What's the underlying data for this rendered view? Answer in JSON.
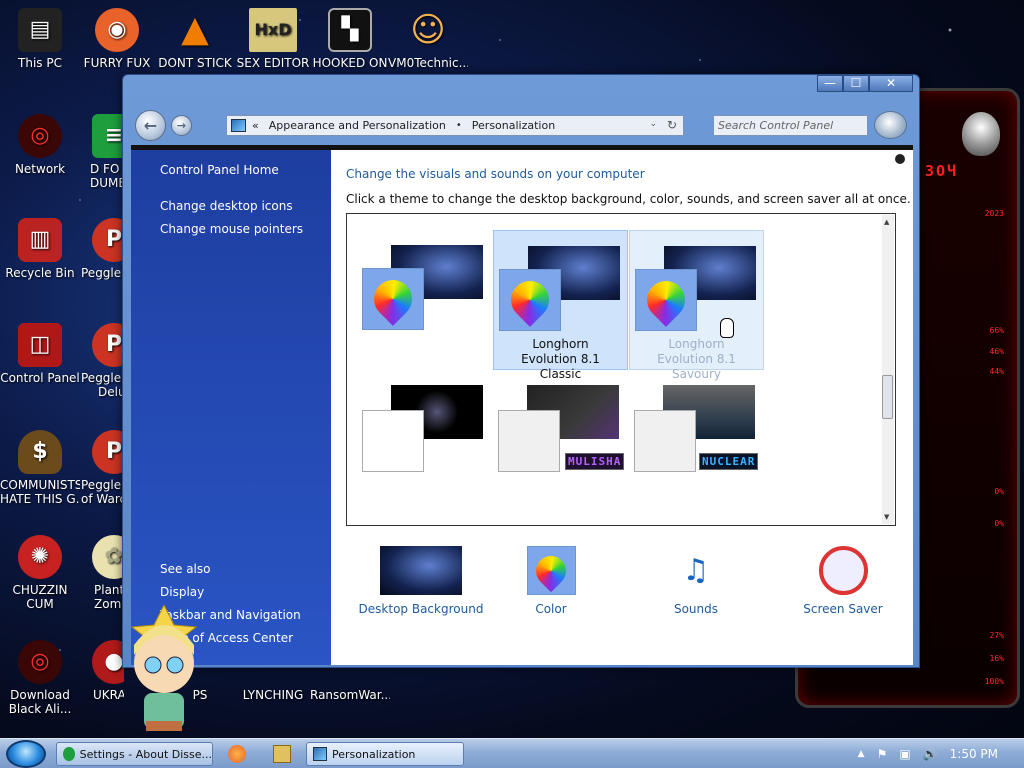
{
  "desktop": {
    "icons": [
      {
        "label": "This PC",
        "color": "#222222",
        "glyph": "▤"
      },
      {
        "label": "FURRY FUX",
        "color": "#e8622a",
        "glyph": "◉"
      },
      {
        "label": "DONT STICK",
        "color": "#f07c00",
        "glyph": "▲"
      },
      {
        "label": "SEX EDITOR",
        "color": "#d6c77d",
        "glyph": "HxD"
      },
      {
        "label": "HOOKED ON",
        "color": "#111111",
        "glyph": "▚"
      },
      {
        "label": "VM0Technic...",
        "color": "#f2b24d",
        "glyph": "☺"
      },
      {
        "label": "Network",
        "color": "#c21f1f",
        "glyph": "◎"
      },
      {
        "label": "D FO\nDUMB",
        "color": "#1e9e3c",
        "glyph": "≡"
      },
      {
        "label": "Recycle Bin",
        "color": "#bb2222",
        "glyph": "▥"
      },
      {
        "label": "Peggle D",
        "color": "#cc3322",
        "glyph": "P"
      },
      {
        "label": "Control Panel",
        "color": "#b01818",
        "glyph": "◫"
      },
      {
        "label": "Peggle N\nDelu",
        "color": "#cc3322",
        "glyph": "P"
      },
      {
        "label": "COMMUNISTS\nHATE THIS G...",
        "color": "#6b4a1c",
        "glyph": "$"
      },
      {
        "label": "Peggle W\nof Warc",
        "color": "#cc3322",
        "glyph": "P"
      },
      {
        "label": "CHUZZIN\nCUM",
        "color": "#c82121",
        "glyph": "✺"
      },
      {
        "label": "Plants\nZomb",
        "color": "#e9e2b0",
        "glyph": "✿"
      },
      {
        "label": "Download\nBlack Ali...",
        "color": "#a81515",
        "glyph": "◎"
      },
      {
        "label": "UKRA",
        "color": "#b01a1a",
        "glyph": "●"
      },
      {
        "label": "PS",
        "color": "#222222",
        "glyph": ""
      },
      {
        "label": "LYNCHING",
        "color": "#222222",
        "glyph": ""
      },
      {
        "label": "RansomWar...",
        "color": "#222222",
        "glyph": ""
      }
    ]
  },
  "alien_gadget": {
    "code": "ЗОЧ",
    "rows": [
      "2023",
      "66%",
      "46%",
      "44%",
      "0%",
      "0%",
      "27%",
      "16%",
      "100%"
    ]
  },
  "window": {
    "controls": {
      "minimize": "—",
      "maximize": "☐",
      "close": "✕"
    },
    "nav": {
      "back": "←",
      "forward": "→"
    },
    "address": {
      "chevron": "«",
      "crumb1": "Appearance and Personalization",
      "separator": "•",
      "crumb2": "Personalization",
      "dropdown": "⌄",
      "refresh": "↻"
    },
    "search_placeholder": "Search Control Panel",
    "left_links": {
      "home": "Control Panel Home",
      "desktop_icons": "Change desktop icons",
      "mouse_pointers": "Change mouse pointers",
      "see_also": "See also",
      "display": "Display",
      "taskbar": "Taskbar and Navigation",
      "access": "Ease of Access Center"
    },
    "heading": "Change the visuals and sounds on your computer",
    "subheading": "Click a theme to change the desktop background, color, sounds, and screen saver all at once.",
    "themes": [
      {
        "label": ""
      },
      {
        "label": "Longhorn Evolution 8.1 Classic"
      },
      {
        "label": "Longhorn Evolution 8.1 Savoury"
      },
      {
        "label": ""
      },
      {
        "label": "",
        "tag": "MULISHA"
      },
      {
        "label": "",
        "tag": "NUCLEAR"
      }
    ],
    "scroll": {
      "up": "▲",
      "down": "▼"
    },
    "bottom": {
      "background": "Desktop Background",
      "color": "Color",
      "sounds": "Sounds",
      "screensaver": "Screen Saver"
    }
  },
  "taskbar": {
    "tasks": [
      {
        "label": "Settings - About Disse..."
      },
      {
        "label": "Personalization"
      }
    ],
    "tray": {
      "arrow": "▲",
      "flag": "⚑",
      "network": "▣",
      "volume": "🔊",
      "time": "1:50 PM"
    }
  },
  "colors": {
    "window_frame": "#5a86c9",
    "left_pane": "#2a55c4",
    "link_blue": "#1e5a9e",
    "selected_theme": "#cfe4fa"
  }
}
